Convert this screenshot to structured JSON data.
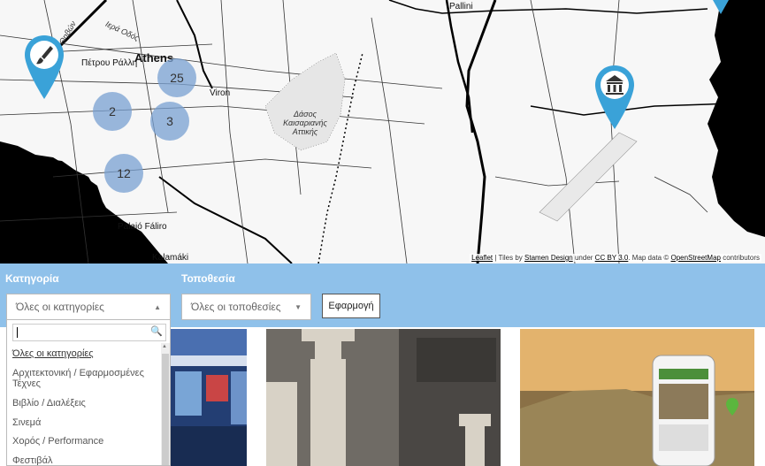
{
  "map": {
    "places": [
      "Pallini",
      "Ιερά Οδός",
      "Πέτρου Ράλλη",
      "Athens",
      "Viron",
      "Δάσος Καισαριανής Αττικής",
      "Palaió Fáliro",
      "Kalamáki",
      "Θηβών"
    ],
    "clusters": [
      "25",
      "2",
      "3",
      "12"
    ],
    "attribution": {
      "leaflet": "Leaflet",
      "tiles": "| Tiles by",
      "stamen": "Stamen Design",
      "under": "under",
      "license": "CC BY 3.0",
      "mapdata": ". Map data ©",
      "osm": "OpenStreetMap",
      "contrib": "contributors"
    },
    "marker_color": "#3aa2d8"
  },
  "filters": {
    "category_label": "Κατηγορία",
    "location_label": "Τοποθεσία",
    "category_value": "Όλες οι κατηγορίες",
    "location_value": "Όλες οι τοποθεσίες",
    "apply_label": "Εφαρμογή",
    "bar_color": "#8fc1ea"
  },
  "dropdown": {
    "search_value": "",
    "items": [
      "Όλες οι κατηγορίες",
      "Αρχιτεκτονική / Εφαρμοσμένες Τέχνες",
      "Βιβλίο / Διαλέξεις",
      "Σινεμά",
      "Χορός / Performance",
      "Φεστιβάλ"
    ]
  }
}
